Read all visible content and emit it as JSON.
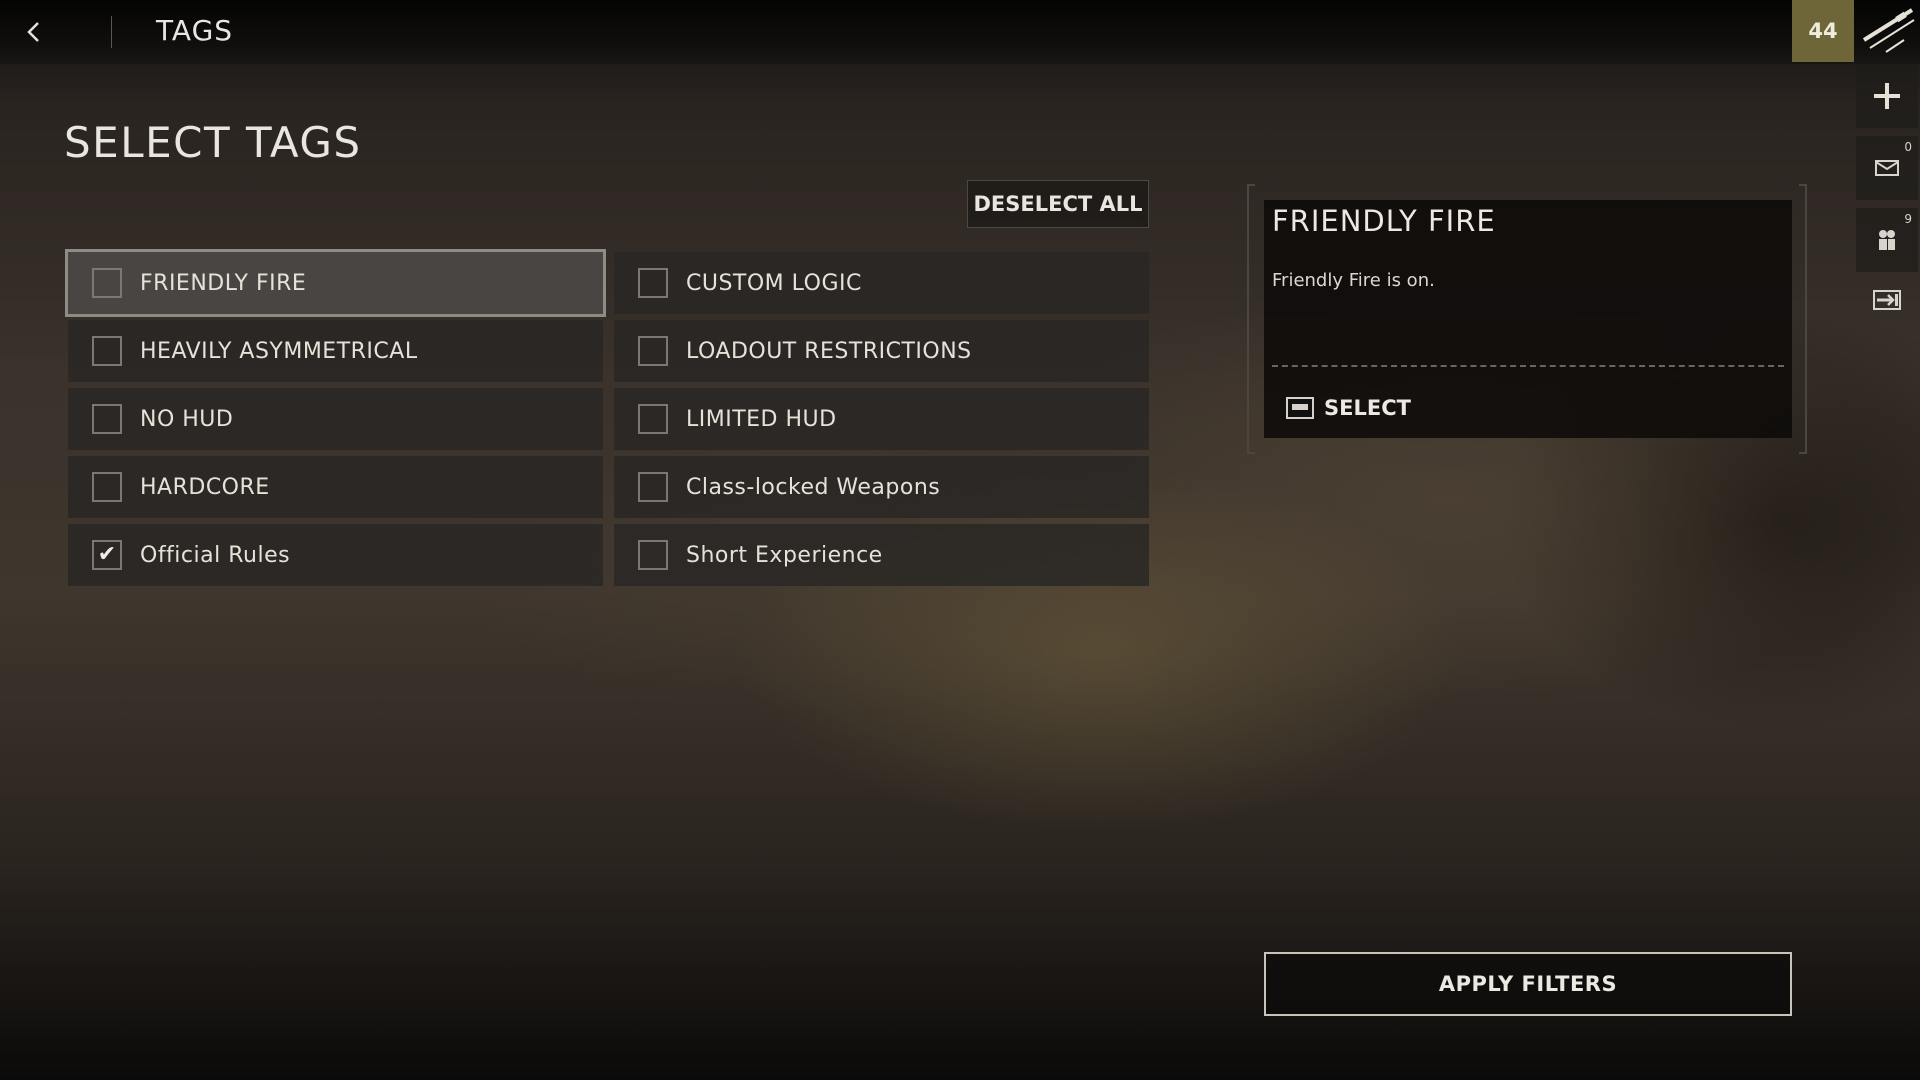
{
  "header": {
    "title": "TAGS",
    "rank": "44"
  },
  "page": {
    "title": "SELECT TAGS",
    "deselect_all": "DESELECT ALL"
  },
  "tags": [
    {
      "label": "FRIENDLY FIRE",
      "checked": false,
      "selected": true
    },
    {
      "label": "CUSTOM LOGIC",
      "checked": false,
      "selected": false
    },
    {
      "label": "HEAVILY ASYMMETRICAL",
      "checked": false,
      "selected": false
    },
    {
      "label": "LOADOUT RESTRICTIONS",
      "checked": false,
      "selected": false
    },
    {
      "label": "NO HUD",
      "checked": false,
      "selected": false
    },
    {
      "label": "LIMITED HUD",
      "checked": false,
      "selected": false
    },
    {
      "label": "HARDCORE",
      "checked": false,
      "selected": false
    },
    {
      "label": "Class-locked Weapons",
      "checked": false,
      "selected": false
    },
    {
      "label": "Official Rules",
      "checked": true,
      "selected": false
    },
    {
      "label": "Short Experience",
      "checked": false,
      "selected": false
    }
  ],
  "detail": {
    "title": "FRIENDLY FIRE",
    "description": "Friendly Fire is on.",
    "select_label": "SELECT"
  },
  "actions": {
    "apply_filters": "APPLY FILTERS"
  },
  "side_rail": {
    "mail_count": "0",
    "squad_count": "9"
  },
  "icons": {
    "back": "chevron-left-icon",
    "weapon": "rifle-icon",
    "add": "plus-icon",
    "mail": "mail-icon",
    "squad": "squad-icon",
    "exit": "exit-icon"
  },
  "colors": {
    "rank_badge": "#6e6539",
    "tag_bg": "#282624",
    "tag_selected_bg": "#4a4844"
  }
}
